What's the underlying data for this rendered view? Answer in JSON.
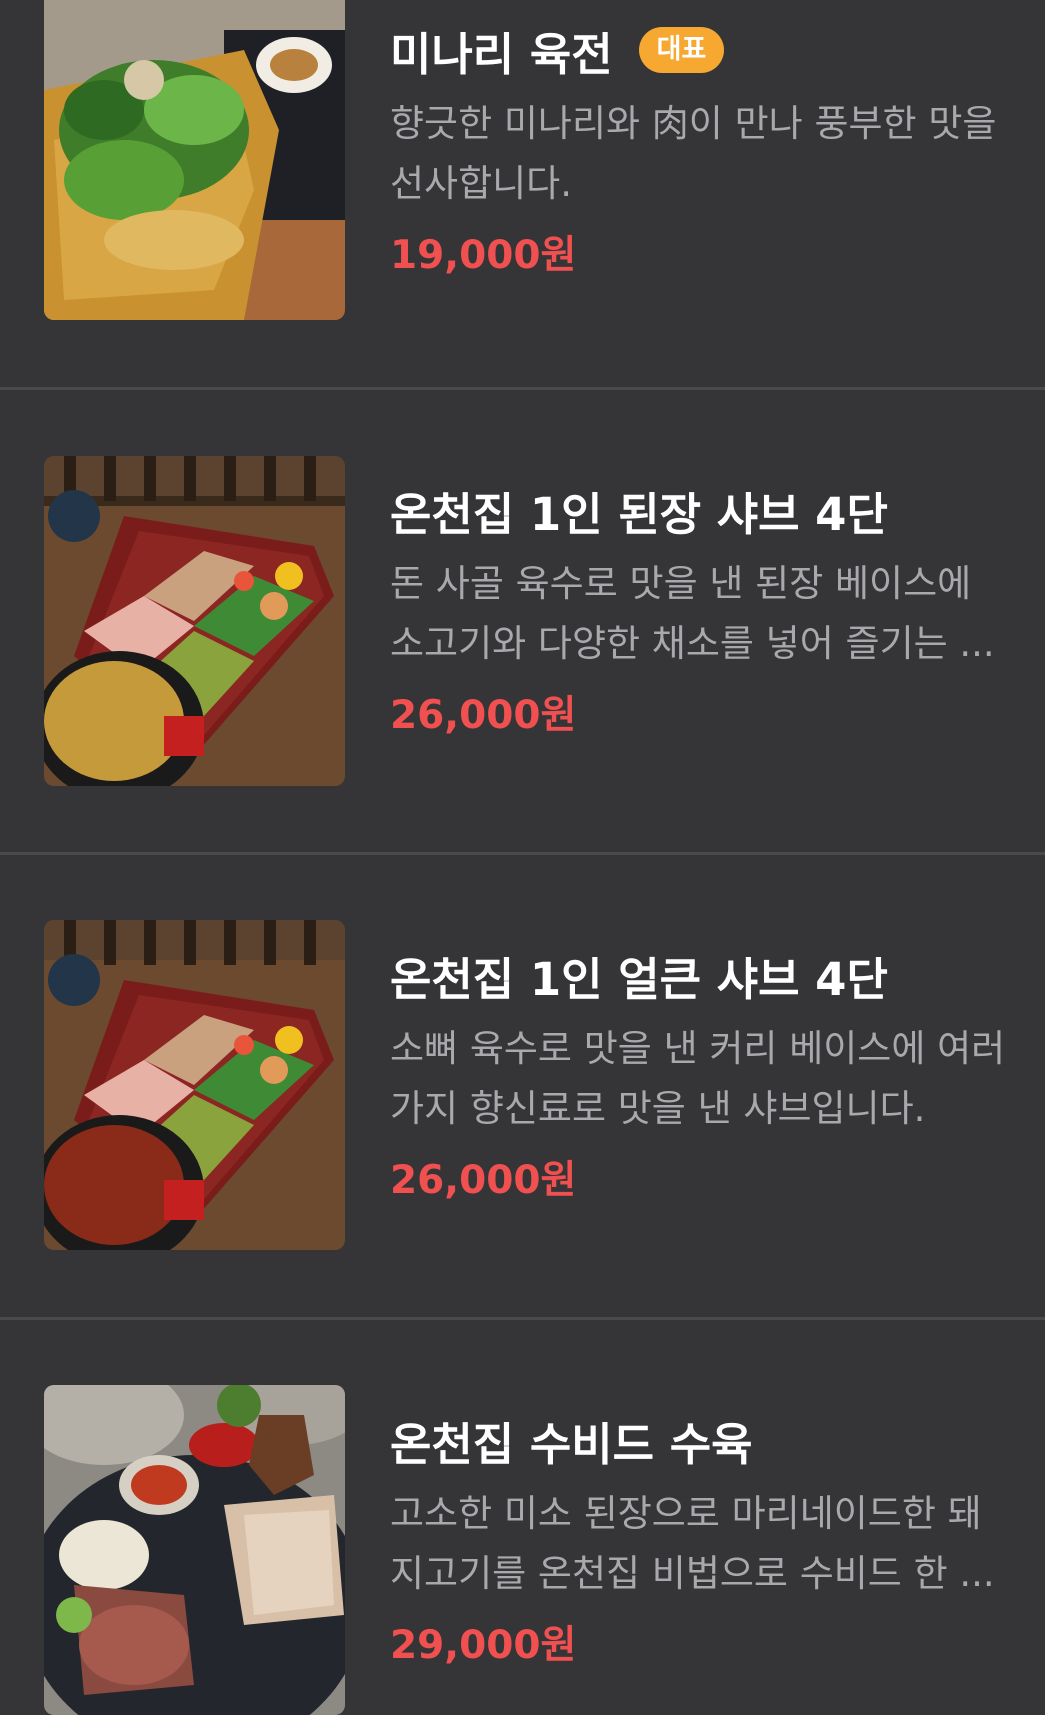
{
  "menu_items": [
    {
      "name": "미나리 육전",
      "badge": "대표",
      "description": "향긋한 미나리와 肉이 만나 풍부한 맛을 선사합니다.",
      "price": "19,000원",
      "image": "minari-jeon-photo"
    },
    {
      "name": "온천집 1인 된장 샤브 4단",
      "badge": "",
      "description": "돈 사골 육수로 맛을 낸 된장 베이스에 소고기와 다양한 채소를 넣어 즐기는 ...",
      "price": "26,000원",
      "image": "doenjang-shabu-photo"
    },
    {
      "name": "온천집 1인 얼큰 샤브 4단",
      "badge": "",
      "description": "소뼈 육수로 맛을 낸 커리 베이스에 여러가지 향신료로 맛을 낸 샤브입니다.",
      "price": "26,000원",
      "image": "spicy-shabu-photo"
    },
    {
      "name": "온천집 수비드 수육",
      "badge": "",
      "description": "고소한 미소 된장으로 마리네이드한 돼지고기를 온천집 비법으로 수비드 한 ...",
      "price": "29,000원",
      "image": "sous-vide-suyuk-photo"
    }
  ],
  "colors": {
    "background": "#353538",
    "divider": "#4a4a4e",
    "title": "#ffffff",
    "description": "#a9a9ad",
    "price": "#f05050",
    "badge": "#f6a830"
  }
}
